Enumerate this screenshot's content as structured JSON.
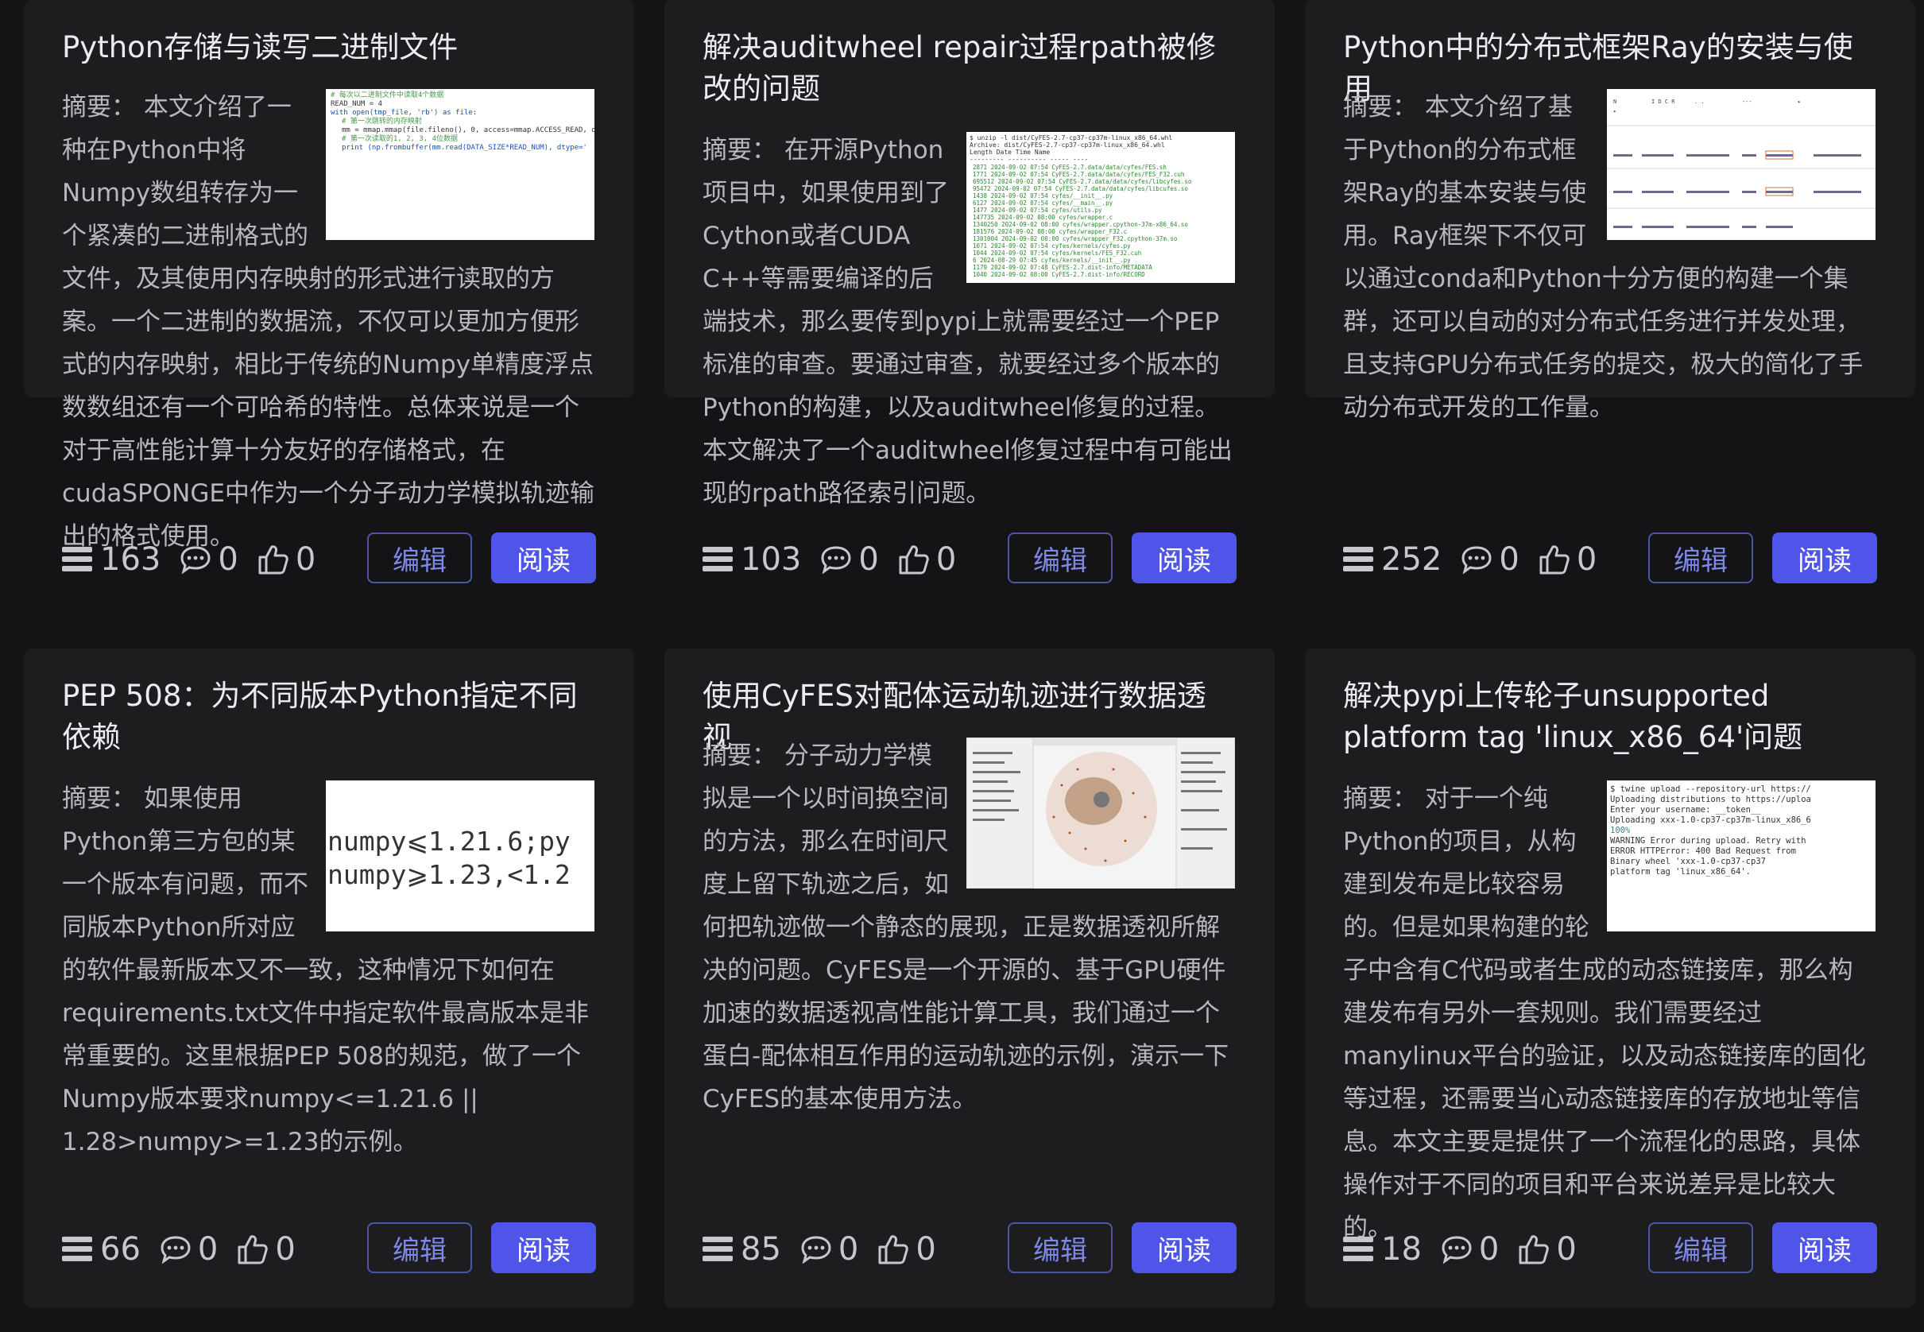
{
  "cards": [
    {
      "title": "Python存储与读写二进制文件",
      "summary_lead": "摘要：  本文介绍了一种在Python中将Numpy数组转存为一个紧凑的二进制格式的文件，及",
      "summary": "其使用内存映射的形式进行读取的方案。一个二进制的数据流，不仅可以更加方便形式的内存映射，相比于传统的Numpy单精度浮点数数组还有一个可哈希的特性。总体来说是一个对于高性能计算十分友好的存储格式，在cudaSPONGE中作为一个分子动力学模拟轨迹输出的格式使用。",
      "reads": "163",
      "comments": "0",
      "likes": "0"
    },
    {
      "title": "解决auditwheel repair过程rpath被修改的问题",
      "summary_lead": "摘要：  在开源Python项目中，如果使用到了Cython或者CUDA C++等需要编译的后端技",
      "summary": "术，那么要传到pypi上就需要经过一个PEP标准的审查。要通过审查，就要经过多个版本的Python的构建，以及auditwheel修复的过程。本文解决了一个auditwheel修复过程中有可能出现的rpath路径索引问题。",
      "reads": "103",
      "comments": "0",
      "likes": "0"
    },
    {
      "title": "Python中的分布式框架Ray的安装与使用",
      "summary_lead": "摘要：  本文介绍了基于Python的分布式框架Ray的基本安装与使用。Ray框架下不仅可以通",
      "summary": "过conda和Python十分方便的构建一个集群，还可以自动的对分布式任务进行并发处理，且支持GPU分布式任务的提交，极大的简化了手动分布式开发的工作量。",
      "reads": "252",
      "comments": "0",
      "likes": "0"
    },
    {
      "title": "PEP 508：为不同版本Python指定不同依赖",
      "summary_lead": "摘要：  如果使用Python第三方包的某一个版本有问题，而不同版本Python所对应的软件最",
      "summary": "新版本又不一致，这种情况下如何在requirements.txt文件中指定软件最高版本是非常重要的。这里根据PEP 508的规范，做了一个Numpy版本要求numpy<=1.21.6 || 1.28>numpy>=1.23的示例。",
      "reads": "66",
      "comments": "0",
      "likes": "0"
    },
    {
      "title": "使用CyFES对配体运动轨迹进行数据透视",
      "summary_lead": "摘要：  分子动力学模拟是一个以时间换空间的方法，那么在时间尺度上留下轨迹之后，如何",
      "summary": "把轨迹做一个静态的展现，正是数据透视所解决的问题。CyFES是一个开源的、基于GPU硬件加速的数据透视高性能计算工具，我们通过一个蛋白-配体相互作用的运动轨迹的示例，演示一下CyFES的基本使用方法。",
      "reads": "85",
      "comments": "0",
      "likes": "0"
    },
    {
      "title": "解决pypi上传轮子unsupported platform tag 'linux_x86_64'问题",
      "summary_lead": "摘要：  对于一个纯Python的项目，从构建到发布是比较容易的。但是如果构建的轮子中含有",
      "summary": "C代码或者生成的动态链接库，那么构建发布有另外一套规则。我们需要经过manylinux平台的验证，以及动态链接库的固化等过程，还需要当心动态链接库的存放地址等信息。本文主要是提供了一个流程化的思路，具体操作对于不同的项目和平台来说差异是比较大的。",
      "reads": "18",
      "comments": "0",
      "likes": "0"
    }
  ],
  "buttons": {
    "edit": "编辑",
    "read": "阅读"
  },
  "thumb_text": {
    "pep508_line1": "numpy⩽1.21.6;py",
    "pep508_line2": "numpy⩾1.23,<1.2",
    "twine_lines": [
      "$ twine upload --repository-url https://",
      "Uploading distributions to https://uploa",
      "Enter your username: __token__",
      "Uploading xxx-1.0-cp37-cp37m-linux_x86_6",
      "100%",
      "WARNING  Error during upload. Retry with",
      "ERROR    HTTPError: 400 Bad Request from",
      "         Binary wheel 'xxx-1.0-cp37-cp37",
      "         platform tag 'linux_x86_64'."
    ]
  }
}
